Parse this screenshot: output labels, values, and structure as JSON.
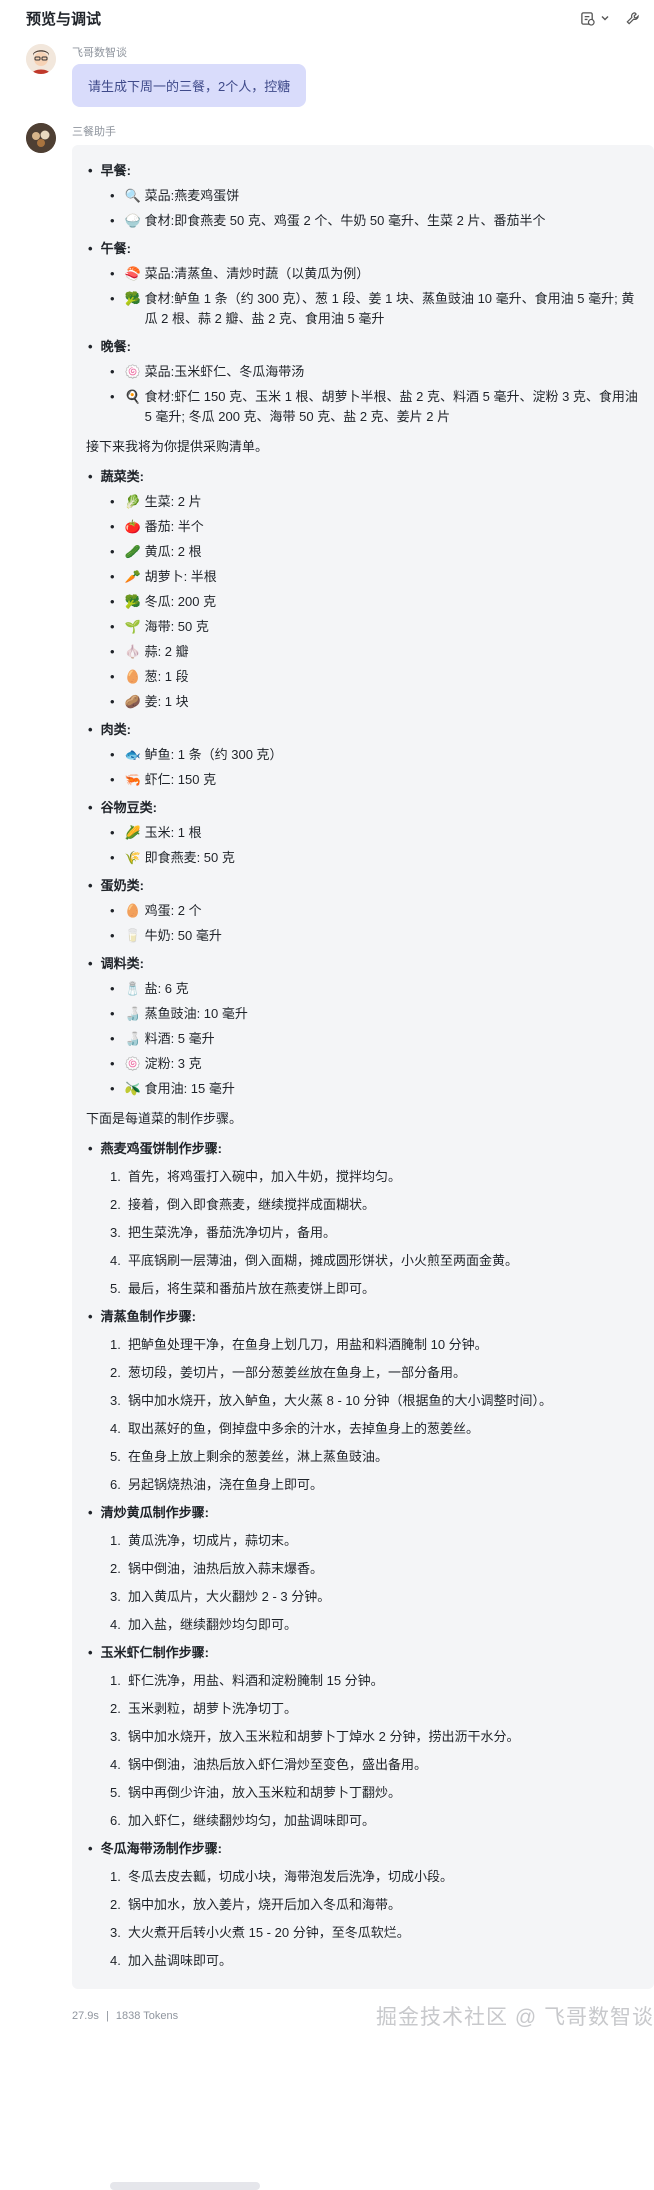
{
  "header": {
    "title": "预览与调试"
  },
  "user": {
    "name": "飞哥数智谈",
    "message": "请生成下周一的三餐，2个人，控糖"
  },
  "bot": {
    "name": "三餐助手",
    "meals": [
      {
        "title": "早餐:",
        "items": [
          {
            "icon": "🔍",
            "label": "菜品:",
            "text": "燕麦鸡蛋饼"
          },
          {
            "icon": "🍚",
            "label": "食材:",
            "text": "即食燕麦 50 克、鸡蛋 2 个、牛奶 50 毫升、生菜 2 片、番茄半个"
          }
        ]
      },
      {
        "title": "午餐:",
        "items": [
          {
            "icon": "🍣",
            "label": "菜品:",
            "text": "清蒸鱼、清炒时蔬（以黄瓜为例）"
          },
          {
            "icon": "🥦",
            "label": "食材:",
            "text": "鲈鱼 1 条（约 300 克）、葱 1 段、姜 1 块、蒸鱼豉油 10 毫升、食用油 5 毫升; 黄瓜 2 根、蒜 2 瓣、盐 2 克、食用油 5 毫升"
          }
        ]
      },
      {
        "title": "晚餐:",
        "items": [
          {
            "icon": "🍥",
            "label": "菜品:",
            "text": "玉米虾仁、冬瓜海带汤"
          },
          {
            "icon": "🍳",
            "label": "食材:",
            "text": "虾仁 150 克、玉米 1 根、胡萝卜半根、盐 2 克、料酒 5 毫升、淀粉 3 克、食用油 5 毫升; 冬瓜 200 克、海带 50 克、盐 2 克、姜片 2 片"
          }
        ]
      }
    ],
    "shopping_intro": "接下来我将为你提供采购清单。",
    "shopping": [
      {
        "title": "蔬菜类:",
        "items": [
          {
            "icon": "🥬",
            "text": "生菜: 2 片"
          },
          {
            "icon": "🍅",
            "text": "番茄: 半个"
          },
          {
            "icon": "🥒",
            "text": "黄瓜: 2 根"
          },
          {
            "icon": "🥕",
            "text": "胡萝卜: 半根"
          },
          {
            "icon": "🥦",
            "text": "冬瓜: 200 克"
          },
          {
            "icon": "🌱",
            "text": "海带: 50 克"
          },
          {
            "icon": "🧄",
            "text": "蒜: 2 瓣"
          },
          {
            "icon": "🥚",
            "text": "葱: 1 段"
          },
          {
            "icon": "🥔",
            "text": "姜: 1 块"
          }
        ]
      },
      {
        "title": "肉类:",
        "items": [
          {
            "icon": "🐟",
            "text": "鲈鱼: 1 条（约 300 克）"
          },
          {
            "icon": "🦐",
            "text": "虾仁: 150 克"
          }
        ]
      },
      {
        "title": "谷物豆类:",
        "items": [
          {
            "icon": "🌽",
            "text": "玉米: 1 根"
          },
          {
            "icon": "🌾",
            "text": "即食燕麦: 50 克"
          }
        ]
      },
      {
        "title": "蛋奶类:",
        "items": [
          {
            "icon": "🥚",
            "text": "鸡蛋: 2 个"
          },
          {
            "icon": "🥛",
            "text": "牛奶: 50 毫升"
          }
        ]
      },
      {
        "title": "调料类:",
        "items": [
          {
            "icon": "🧂",
            "text": "盐: 6 克"
          },
          {
            "icon": "🍶",
            "text": "蒸鱼豉油: 10 毫升"
          },
          {
            "icon": "🍶",
            "text": "料酒: 5 毫升"
          },
          {
            "icon": "🍥",
            "text": "淀粉: 3 克"
          },
          {
            "icon": "🫒",
            "text": "食用油: 15 毫升"
          }
        ]
      }
    ],
    "steps_intro": "下面是每道菜的制作步骤。",
    "recipes": [
      {
        "title": "燕麦鸡蛋饼制作步骤:",
        "steps": [
          "首先，将鸡蛋打入碗中，加入牛奶，搅拌均匀。",
          "接着，倒入即食燕麦，继续搅拌成面糊状。",
          "把生菜洗净，番茄洗净切片，备用。",
          "平底锅刷一层薄油，倒入面糊，摊成圆形饼状，小火煎至两面金黄。",
          "最后，将生菜和番茄片放在燕麦饼上即可。"
        ]
      },
      {
        "title": "清蒸鱼制作步骤:",
        "steps": [
          "把鲈鱼处理干净，在鱼身上划几刀，用盐和料酒腌制 10 分钟。",
          "葱切段，姜切片，一部分葱姜丝放在鱼身上，一部分备用。",
          "锅中加水烧开，放入鲈鱼，大火蒸 8 - 10 分钟（根据鱼的大小调整时间）。",
          "取出蒸好的鱼，倒掉盘中多余的汁水，去掉鱼身上的葱姜丝。",
          "在鱼身上放上剩余的葱姜丝，淋上蒸鱼豉油。",
          "另起锅烧热油，浇在鱼身上即可。"
        ]
      },
      {
        "title": "清炒黄瓜制作步骤:",
        "steps": [
          "黄瓜洗净，切成片，蒜切末。",
          "锅中倒油，油热后放入蒜末爆香。",
          "加入黄瓜片，大火翻炒 2 - 3 分钟。",
          "加入盐，继续翻炒均匀即可。"
        ]
      },
      {
        "title": "玉米虾仁制作步骤:",
        "steps": [
          "虾仁洗净，用盐、料酒和淀粉腌制 15 分钟。",
          "玉米剥粒，胡萝卜洗净切丁。",
          "锅中加水烧开，放入玉米粒和胡萝卜丁焯水 2 分钟，捞出沥干水分。",
          "锅中倒油，油热后放入虾仁滑炒至变色，盛出备用。",
          "锅中再倒少许油，放入玉米粒和胡萝卜丁翻炒。",
          "加入虾仁，继续翻炒均匀，加盐调味即可。"
        ]
      },
      {
        "title": "冬瓜海带汤制作步骤:",
        "steps": [
          "冬瓜去皮去瓤，切成小块，海带泡发后洗净，切成小段。",
          "锅中加水，放入姜片，烧开后加入冬瓜和海带。",
          "大火煮开后转小火煮 15 - 20 分钟，至冬瓜软烂。",
          "加入盐调味即可。"
        ]
      }
    ],
    "stats": {
      "time": "27.9s",
      "divider": "|",
      "tokens": "1838 Tokens"
    }
  },
  "watermark": "掘金技术社区 @ 飞哥数智谈"
}
